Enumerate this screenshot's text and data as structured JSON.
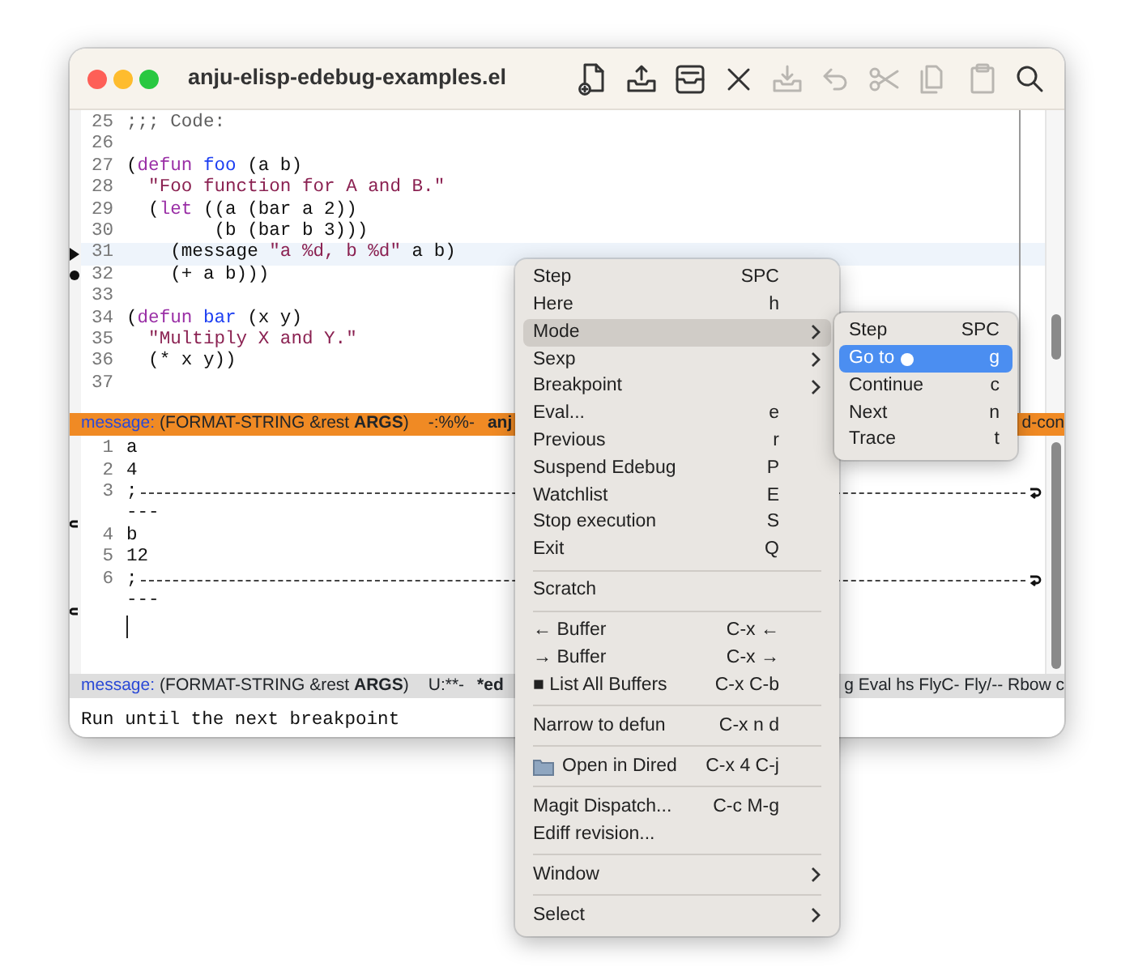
{
  "window": {
    "title": "anju-elisp-edebug-examples.el"
  },
  "toolbar": [
    {
      "disabled": false
    },
    {
      "disabled": false
    },
    {
      "disabled": false
    },
    {
      "disabled": false
    },
    {
      "disabled": true
    },
    {
      "disabled": true
    },
    {
      "disabled": true
    },
    {
      "disabled": true
    },
    {
      "disabled": true
    },
    {
      "disabled": false
    }
  ],
  "editor": {
    "lines": [
      {
        "number": "25",
        "highlighted": false,
        "breakpoint": false,
        "segments": [
          {
            "text": ";;; Code:",
            "kind": "comment"
          }
        ]
      },
      {
        "number": "26",
        "highlighted": false,
        "breakpoint": false
      },
      {
        "number": "27",
        "highlighted": false,
        "breakpoint": false,
        "segments": [
          {
            "text": "(",
            "kind": "plain"
          },
          {
            "text": "defun",
            "kind": "keyword"
          },
          {
            "text": " foo",
            "kind": "function"
          },
          {
            "text": " (a b)",
            "kind": "plain"
          }
        ]
      },
      {
        "number": "28",
        "highlighted": false,
        "breakpoint": false,
        "segments": [
          {
            "text": "  \"Foo function for A and B.\"",
            "kind": "string"
          }
        ]
      },
      {
        "number": "29",
        "highlighted": false,
        "breakpoint": false,
        "segments": [
          {
            "text": "  (",
            "kind": "plain"
          },
          {
            "text": "let",
            "kind": "keyword"
          },
          {
            "text": " ((a (bar a 2))",
            "kind": "plain"
          }
        ]
      },
      {
        "number": "30",
        "highlighted": false,
        "breakpoint": false,
        "segments": [
          {
            "text": "        (b (bar b 3)))",
            "kind": "plain"
          }
        ]
      },
      {
        "number": "31",
        "highlighted": true,
        "breakpoint": false,
        "segments": [
          {
            "text": "    (message ",
            "kind": "plain"
          },
          {
            "text": "\"a %d, b %d\"",
            "kind": "string"
          },
          {
            "text": " a b)",
            "kind": "plain"
          }
        ]
      },
      {
        "number": "32",
        "highlighted": false,
        "breakpoint": true,
        "segments": [
          {
            "text": "    (+ a b)))",
            "kind": "plain"
          }
        ]
      },
      {
        "number": "33",
        "highlighted": false,
        "breakpoint": false
      },
      {
        "number": "34",
        "highlighted": false,
        "breakpoint": false,
        "segments": [
          {
            "text": "(",
            "kind": "plain"
          },
          {
            "text": "defun",
            "kind": "keyword"
          },
          {
            "text": " bar",
            "kind": "function"
          },
          {
            "text": " (x y)",
            "kind": "plain"
          }
        ]
      },
      {
        "number": "35",
        "highlighted": false,
        "breakpoint": false,
        "segments": [
          {
            "text": "  \"Multiply X and Y.\"",
            "kind": "string"
          }
        ]
      },
      {
        "number": "36",
        "highlighted": false,
        "breakpoint": false,
        "segments": [
          {
            "text": "  (* x y))",
            "kind": "plain"
          }
        ]
      },
      {
        "number": "37",
        "highlighted": false,
        "breakpoint": false
      }
    ]
  },
  "mode_line_top": {
    "function": "message:",
    "signature": "(FORMAT-STRING &rest **ARGS**)",
    "status": "-:%%-",
    "buffer": "anj",
    "tail": "d-con"
  },
  "results": {
    "lines": [
      {
        "kind": "text",
        "number": "1",
        "text": "a"
      },
      {
        "kind": "text",
        "number": "2",
        "text": "4"
      },
      {
        "kind": "rule",
        "number": "3",
        "text": ";"
      },
      {
        "kind": "continuation",
        "text": "---"
      },
      {
        "kind": "text",
        "number": "4",
        "text": "b"
      },
      {
        "kind": "text",
        "number": "5",
        "text": "12"
      },
      {
        "kind": "rule",
        "number": "6",
        "text": ";"
      },
      {
        "kind": "continuation",
        "text": "---"
      },
      {
        "kind": "cursor"
      }
    ]
  },
  "mode_line_bottom": {
    "function": "message:",
    "signature": "(FORMAT-STRING &rest **ARGS**)",
    "status": "U:**-",
    "buffer": "*ed",
    "tail": "g Eval hs FlyC- Fly/-- Rbow c"
  },
  "echo_area": "Run until the next breakpoint",
  "menu": [
    {
      "kind": "item",
      "label": "Step",
      "shortcut": "SPC",
      "selected": false
    },
    {
      "kind": "item",
      "label": "Here",
      "shortcut": "h",
      "selected": false
    },
    {
      "kind": "submenu",
      "label": "Mode",
      "selected": true
    },
    {
      "kind": "submenu",
      "label": "Sexp",
      "selected": false
    },
    {
      "kind": "submenu",
      "label": "Breakpoint",
      "selected": false
    },
    {
      "kind": "item",
      "label": "Eval...",
      "shortcut": "e",
      "selected": false
    },
    {
      "kind": "item",
      "label": "Previous",
      "shortcut": "r",
      "selected": false
    },
    {
      "kind": "item",
      "label": "Suspend Edebug",
      "shortcut": "P",
      "selected": false
    },
    {
      "kind": "item",
      "label": "Watchlist",
      "shortcut": "E",
      "selected": false
    },
    {
      "kind": "item",
      "label": "Stop execution",
      "shortcut": "S",
      "selected": false
    },
    {
      "kind": "item",
      "label": "Exit",
      "shortcut": "Q",
      "selected": false
    },
    {
      "kind": "separator"
    },
    {
      "kind": "item",
      "label": "Scratch",
      "selected": false
    },
    {
      "kind": "separator"
    },
    {
      "kind": "item",
      "label": "← Buffer",
      "shortcut": "C-x ←",
      "selected": false
    },
    {
      "kind": "item",
      "label": "→ Buffer",
      "shortcut": "C-x →",
      "selected": false
    },
    {
      "kind": "item",
      "label": "■ List All Buffers",
      "shortcut": "C-x C-b",
      "selected": false
    },
    {
      "kind": "separator"
    },
    {
      "kind": "item",
      "label": "Narrow to defun",
      "shortcut": "C-x n d",
      "selected": false
    },
    {
      "kind": "separator"
    },
    {
      "kind": "folder",
      "label": "Open in Dired",
      "shortcut": "C-x 4 C-j",
      "selected": false
    },
    {
      "kind": "separator"
    },
    {
      "kind": "item",
      "label": "Magit Dispatch...",
      "shortcut": "C-c M-g",
      "selected": false
    },
    {
      "kind": "item",
      "label": "Ediff revision...",
      "selected": false
    },
    {
      "kind": "separator"
    },
    {
      "kind": "submenu",
      "label": "Window",
      "selected": false
    },
    {
      "kind": "separator"
    },
    {
      "kind": "submenu",
      "label": "Select",
      "selected": false
    }
  ],
  "submenu": [
    {
      "label": "Step",
      "shortcut": "SPC",
      "selected": false
    },
    {
      "label": "Go to",
      "shortcut": "g",
      "selected": true
    },
    {
      "label": "Continue",
      "shortcut": "c",
      "selected": false
    },
    {
      "label": "Next",
      "shortcut": "n",
      "selected": false
    },
    {
      "label": "Trace",
      "shortcut": "t",
      "selected": false
    }
  ]
}
